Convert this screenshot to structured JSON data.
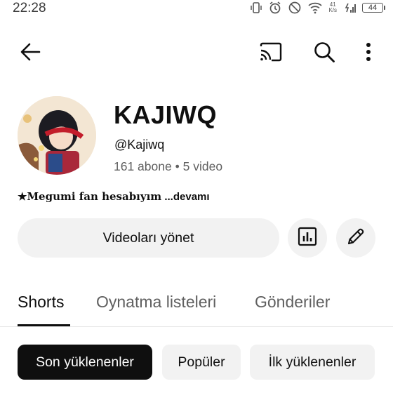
{
  "status_bar": {
    "time": "22:28",
    "net_speed_value": "41",
    "net_speed_unit": "K/s",
    "battery": "44"
  },
  "channel": {
    "name": "KAJIWQ",
    "handle": "@Kajiwq",
    "subscribers": "161 abone",
    "separator": "•",
    "video_count": "5 video",
    "description": "★Megumi fan hesabıyım",
    "more_label": "...devamı"
  },
  "actions": {
    "manage_videos": "Videoları yönet"
  },
  "tabs": [
    {
      "label": "Shorts"
    },
    {
      "label": "Oynatma listeleri"
    },
    {
      "label": "Gönderiler"
    }
  ],
  "chips": [
    {
      "label": "Son yüklenenler"
    },
    {
      "label": "Popüler"
    },
    {
      "label": "İlk yüklenenler"
    }
  ],
  "icons": {
    "back": "arrow-left-icon",
    "cast": "cast-icon",
    "search": "search-icon",
    "more": "more-vert-icon",
    "analytics": "analytics-icon",
    "edit": "pencil-icon"
  },
  "colors": {
    "text_primary": "#0f0f0f",
    "text_secondary": "#606060",
    "chip_selected_bg": "#0f0f0f",
    "chip_bg": "#f2f2f2"
  }
}
